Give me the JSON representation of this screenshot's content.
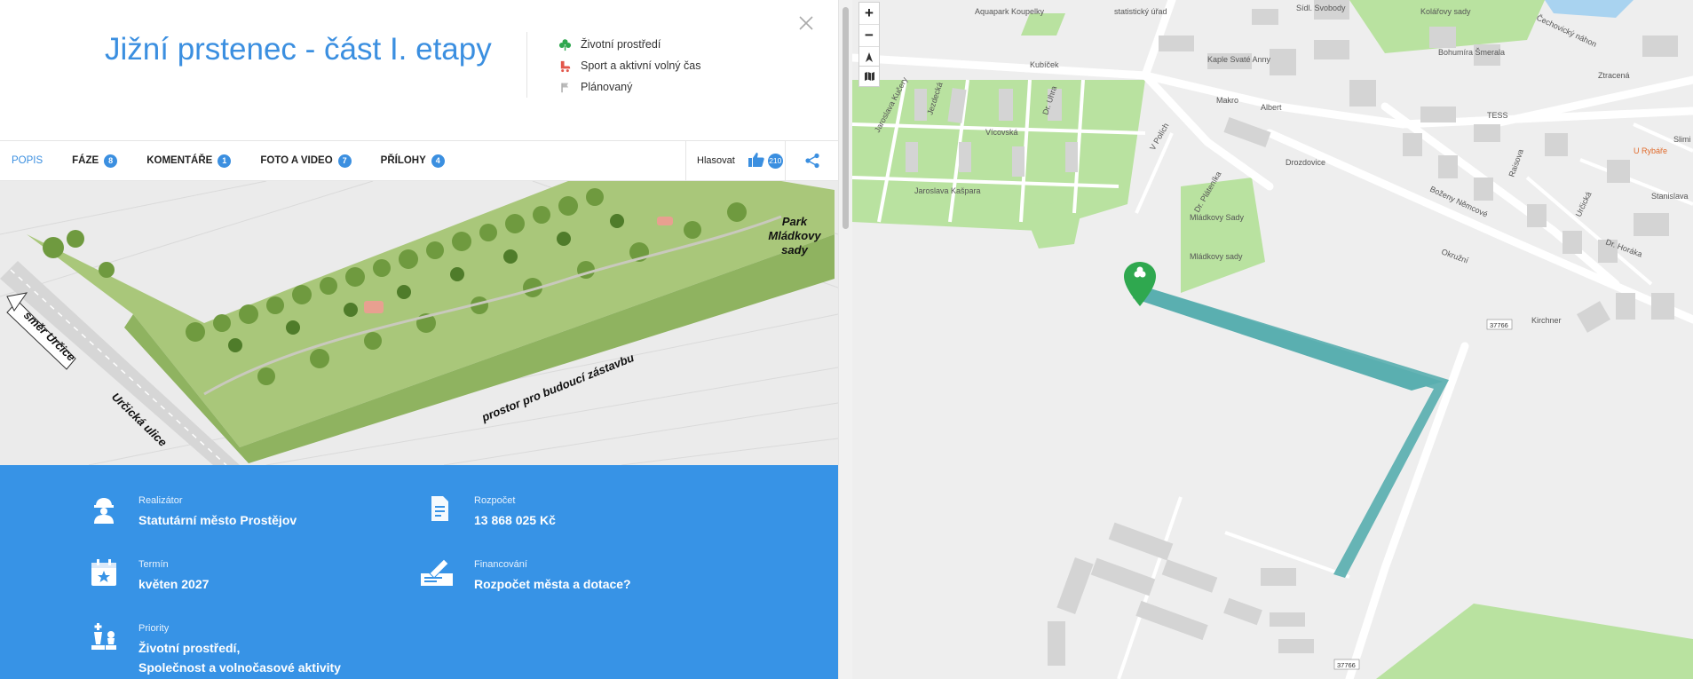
{
  "project": {
    "title": "Jižní prstenec - část I. etapy",
    "tags": [
      {
        "icon": "clover-icon",
        "label": "Životní prostředí",
        "color": "#2fa84f"
      },
      {
        "icon": "rollerskate-icon",
        "label": "Sport a aktivní volný čas",
        "color": "#e2564a"
      },
      {
        "icon": "flag-icon",
        "label": "Plánovaný",
        "color": "#999999"
      }
    ]
  },
  "tabs": [
    {
      "label": "POPIS",
      "active": true
    },
    {
      "label": "FÁZE",
      "count": "8"
    },
    {
      "label": "KOMENTÁŘE",
      "count": "1"
    },
    {
      "label": "FOTO A VIDEO",
      "count": "7"
    },
    {
      "label": "PŘÍLOHY",
      "count": "4"
    }
  ],
  "vote": {
    "label": "Hlasovat",
    "count": "210"
  },
  "visualization": {
    "labels": [
      "Park Mládkovy sady",
      "směr Určice",
      "Určická ulice",
      "prostor pro budoucí zástavbu"
    ]
  },
  "info": {
    "realizator": {
      "label": "Realizátor",
      "value": "Statutární město Prostějov"
    },
    "rozpocet": {
      "label": "Rozpočet",
      "value": "13 868 025 Kč"
    },
    "termin": {
      "label": "Termín",
      "value": "květen 2027"
    },
    "financovani": {
      "label": "Financování",
      "value": "Rozpočet města a dotace?"
    },
    "priority": {
      "label": "Priority",
      "value_line1": "Životní prostředí,",
      "value_line2": "Společnost a volnočasové aktivity"
    }
  },
  "map": {
    "accent": "#5aafb0",
    "marker_color": "#2fa84f",
    "streets": [
      "Aquapark Koupelky",
      "statistický úřad",
      "Sídl. Svobody",
      "Kolářovy sady",
      "Čechovický náhon",
      "Bohumíra Šmerala",
      "Ztracená",
      "Jaroslava Kučery",
      "Jezdecká",
      "Dr. Uhra",
      "Vícovská",
      "V Polích",
      "Jaroslava Kašpara",
      "Dr. Pláteníka",
      "Drozdovice",
      "Boženy Němcové",
      "Raisova",
      "Okružní",
      "Určická",
      "Dr. Horáka",
      "Kirchner",
      "Mládkovy Sady",
      "Mládkovy sady",
      "Kubíček",
      "Kaple Svaté Anny",
      "Makro",
      "Albert",
      "TESS",
      "U Rybáře",
      "Stanislava",
      "Slimi"
    ],
    "road_numbers": [
      "37766",
      "37766"
    ]
  }
}
